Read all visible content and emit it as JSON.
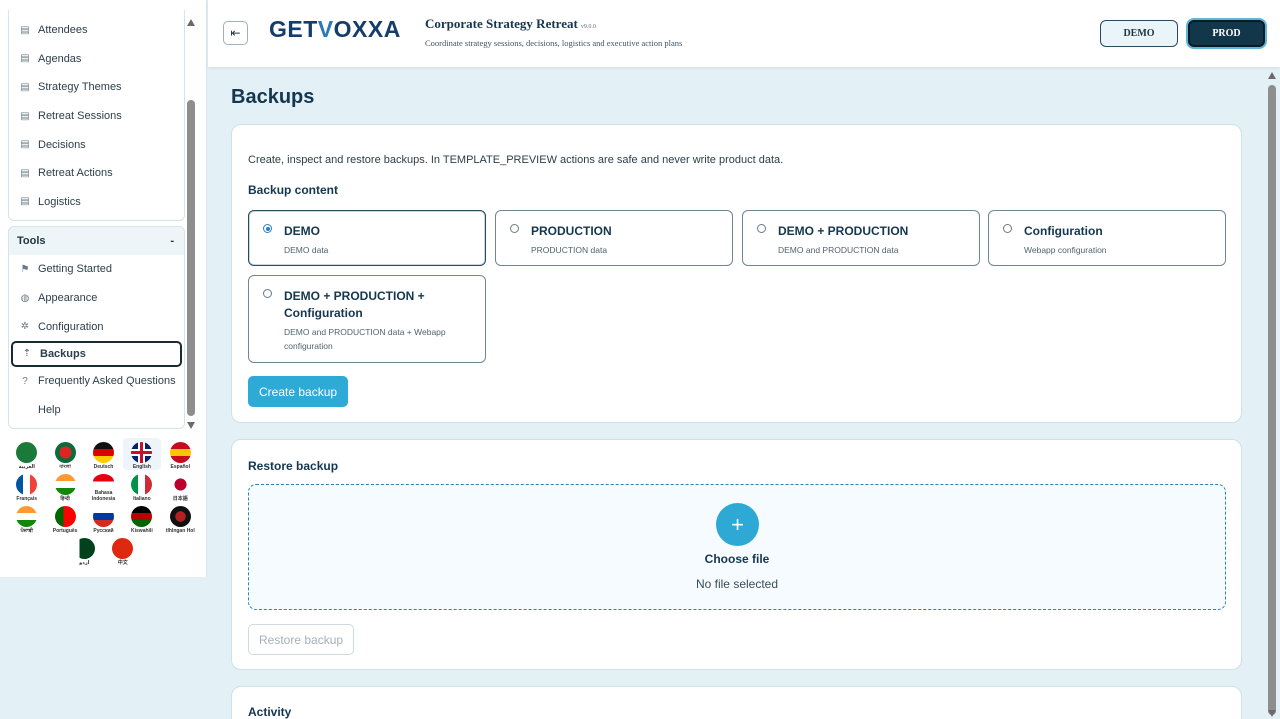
{
  "sidebar": {
    "top_items": [
      {
        "label": "Attendees",
        "icon": "list-icon"
      },
      {
        "label": "Agendas",
        "icon": "list-icon"
      },
      {
        "label": "Strategy Themes",
        "icon": "list-icon"
      },
      {
        "label": "Retreat Sessions",
        "icon": "list-icon"
      },
      {
        "label": "Decisions",
        "icon": "list-icon"
      },
      {
        "label": "Retreat Actions",
        "icon": "list-icon"
      },
      {
        "label": "Logistics",
        "icon": "list-icon"
      }
    ],
    "tools_header": "Tools",
    "tools_toggle": "-",
    "tools_items": [
      {
        "label": "Getting Started",
        "icon": "flag-icon"
      },
      {
        "label": "Appearance",
        "icon": "palette-icon"
      },
      {
        "label": "Configuration",
        "icon": "gear-icon"
      },
      {
        "label": "Backups",
        "icon": "upload-icon"
      },
      {
        "label": "Frequently Asked Questions",
        "icon": "help-icon"
      },
      {
        "label": "Help",
        "icon": ""
      }
    ],
    "active_item": "Backups"
  },
  "languages": [
    {
      "name": "العربية",
      "colors": [
        "#1b7a3a",
        "#1b7a3a"
      ]
    },
    {
      "name": "বাংলা",
      "colors": [
        "#0b6b3a",
        "#e02424"
      ]
    },
    {
      "name": "Deutsch",
      "colors": [
        "#111111",
        "#dd0000",
        "#ffcc00"
      ]
    },
    {
      "name": "English",
      "colors": [
        "#012169",
        "#ffffff",
        "#c8102e"
      ]
    },
    {
      "name": "Español",
      "colors": [
        "#c60b1e",
        "#ffc400",
        "#c60b1e"
      ]
    },
    {
      "name": "Français",
      "colors": [
        "#0055a4",
        "#ffffff",
        "#ef4135"
      ]
    },
    {
      "name": "हिन्दी",
      "colors": [
        "#ff9933",
        "#ffffff",
        "#138808"
      ]
    },
    {
      "name": "Bahasa Indonesia",
      "colors": [
        "#e70011",
        "#ffffff"
      ]
    },
    {
      "name": "Italiano",
      "colors": [
        "#009246",
        "#ffffff",
        "#ce2b37"
      ]
    },
    {
      "name": "日本語",
      "colors": [
        "#ffffff",
        "#bc002d"
      ]
    },
    {
      "name": "ਪੰਜਾਬੀ",
      "colors": [
        "#ff9933",
        "#ffffff",
        "#138808"
      ]
    },
    {
      "name": "Português",
      "colors": [
        "#006600",
        "#ff0000"
      ]
    },
    {
      "name": "Русский",
      "colors": [
        "#ffffff",
        "#0039a6",
        "#d52b1e"
      ]
    },
    {
      "name": "Kiswahili",
      "colors": [
        "#000000",
        "#bb0000",
        "#006600"
      ]
    },
    {
      "name": "tlhIngan Hol",
      "colors": [
        "#111111",
        "#b22222"
      ]
    },
    {
      "name": "اردو",
      "colors": [
        "#01411c",
        "#ffffff"
      ]
    },
    {
      "name": "中文",
      "colors": [
        "#de2910",
        "#ffde00"
      ]
    }
  ],
  "header": {
    "logo_text_pre": "GET",
    "logo_text_v": "V",
    "logo_text_post": "OXXA",
    "app_title": "Corporate Strategy Retreat",
    "version": "v9.0.0",
    "subtitle": "Coordinate strategy sessions, decisions, logistics and executive action plans",
    "env_demo": "DEMO",
    "env_prod": "PROD",
    "toggle_icon": "collapse-menu-icon"
  },
  "main": {
    "page_title": "Backups",
    "backup_card": {
      "intro": "Create, inspect and restore backups. In TEMPLATE_PREVIEW actions are safe and never write product data.",
      "section_title": "Backup content",
      "options": [
        {
          "title": "DEMO",
          "desc": "DEMO data",
          "checked": true
        },
        {
          "title": "PRODUCTION",
          "desc": "PRODUCTION data",
          "checked": false
        },
        {
          "title": "DEMO + PRODUCTION",
          "desc": "DEMO and PRODUCTION data",
          "checked": false
        },
        {
          "title": "Configuration",
          "desc": "Webapp configuration",
          "checked": false
        },
        {
          "title": "DEMO + PRODUCTION + Configuration",
          "desc": "DEMO and PRODUCTION data + Webapp configuration",
          "checked": false
        }
      ],
      "create_button": "Create backup"
    },
    "restore_card": {
      "section_title": "Restore backup",
      "plus": "+",
      "choose_file": "Choose file",
      "no_file": "No file selected",
      "restore_button": "Restore backup"
    },
    "activity_card": {
      "section_title": "Activity"
    }
  },
  "colors": {
    "accent": "#2eaad6",
    "primary_dark": "#14374f",
    "background": "#e3f1f7"
  }
}
